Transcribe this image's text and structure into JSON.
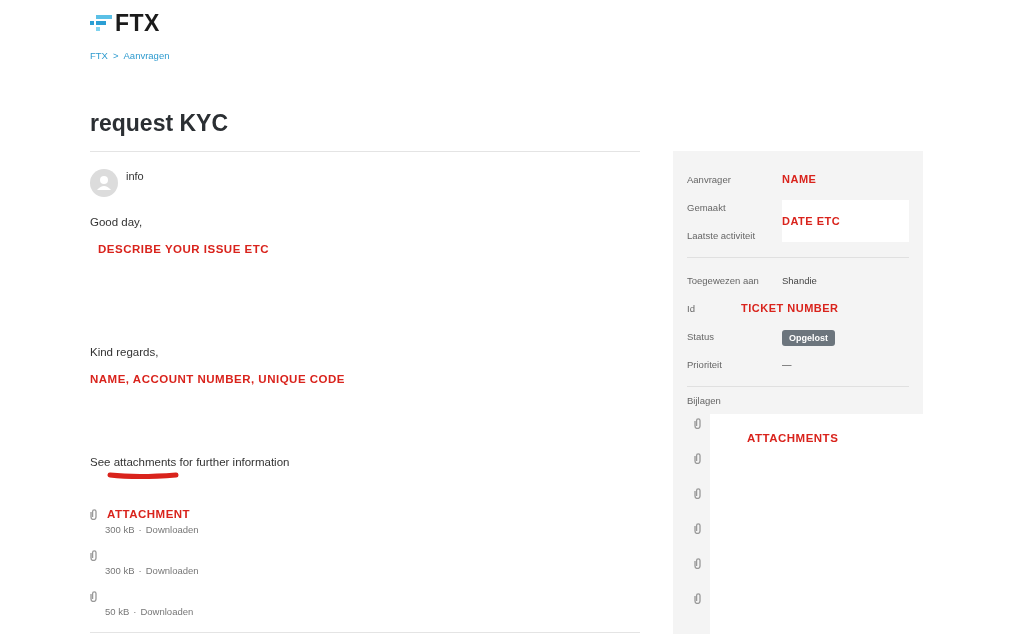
{
  "logo": {
    "text": "FTX"
  },
  "breadcrumb": {
    "items": [
      {
        "label": "FTX"
      },
      {
        "label": "Aanvragen"
      }
    ],
    "separator": ">"
  },
  "title": "request KYC",
  "message": {
    "author": "info",
    "greeting": "Good day,",
    "issue_annotation": "DESCRIBE YOUR ISSUE ETC",
    "closing": "Kind regards,",
    "signature_annotation": "NAME, ACCOUNT NUMBER, UNIQUE CODE",
    "note": {
      "before": "See",
      "link": "attachments",
      "after": "for further information"
    },
    "meta_separator": "·",
    "attachments": [
      {
        "annotation": "ATTACHMENT",
        "size": "300 kB",
        "action": "Downloaden"
      },
      {
        "size": "300 kB",
        "action": "Downloaden"
      },
      {
        "size": "50 kB",
        "action": "Downloaden"
      }
    ]
  },
  "sidebar": {
    "requester": {
      "label": "Aanvrager",
      "annotation": "NAME"
    },
    "created": {
      "label": "Gemaakt"
    },
    "last_activity": {
      "label": "Laatste activiteit"
    },
    "date_annotation": "DATE ETC",
    "assignee": {
      "label": "Toegewezen aan",
      "value": "Shandie"
    },
    "id": {
      "label": "Id",
      "annotation": "TICKET NUMBER"
    },
    "status": {
      "label": "Status",
      "value": "Opgelost"
    },
    "priority": {
      "label": "Prioriteit",
      "value": "—"
    },
    "attachments": {
      "label": "Bijlagen",
      "annotation": "ATTACHMENTS",
      "files": [
        {
          "kind": "file"
        },
        {
          "kind": "file"
        },
        {
          "kind": "file"
        },
        {
          "kind": "file"
        },
        {
          "kind": "file"
        },
        {
          "kind": "file"
        }
      ]
    }
  }
}
